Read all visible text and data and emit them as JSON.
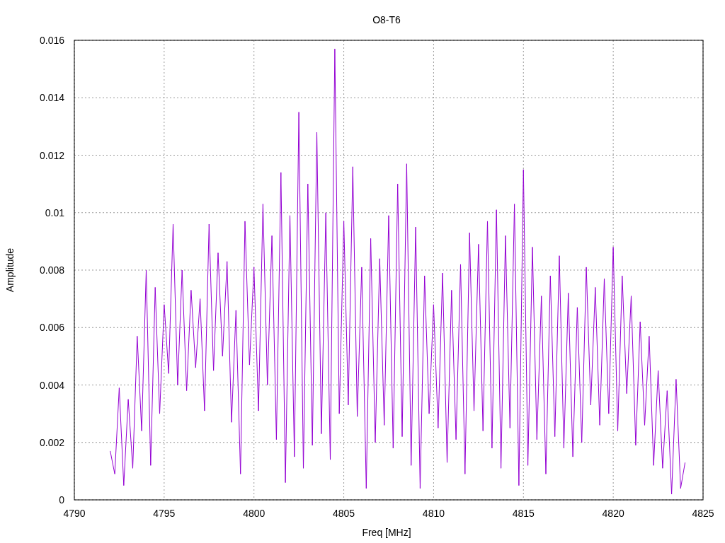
{
  "chart_data": {
    "type": "line",
    "title": "O8-T6",
    "xlabel": "Freq [MHz]",
    "ylabel": "Amplitude",
    "grid": true,
    "xlim": [
      4790,
      4825
    ],
    "ylim": [
      0,
      0.016
    ],
    "xticks": [
      4790,
      4795,
      4800,
      4805,
      4810,
      4815,
      4820,
      4825
    ],
    "yticks": [
      0,
      0.002,
      0.004,
      0.006,
      0.008,
      0.01,
      0.012,
      0.014,
      0.016
    ],
    "x": [
      4792,
      4792.25,
      4792.5,
      4792.75,
      4793,
      4793.25,
      4793.5,
      4793.75,
      4794,
      4794.25,
      4794.5,
      4794.75,
      4795,
      4795.25,
      4795.5,
      4795.75,
      4796,
      4796.25,
      4796.5,
      4796.75,
      4797,
      4797.25,
      4797.5,
      4797.75,
      4798,
      4798.25,
      4798.5,
      4798.75,
      4799,
      4799.25,
      4799.5,
      4799.75,
      4800,
      4800.25,
      4800.5,
      4800.75,
      4801,
      4801.25,
      4801.5,
      4801.75,
      4802,
      4802.25,
      4802.5,
      4802.75,
      4803,
      4803.25,
      4803.5,
      4803.75,
      4804,
      4804.25,
      4804.5,
      4804.75,
      4805,
      4805.25,
      4805.5,
      4805.75,
      4806,
      4806.25,
      4806.5,
      4806.75,
      4807,
      4807.25,
      4807.5,
      4807.75,
      4808,
      4808.25,
      4808.5,
      4808.75,
      4809,
      4809.25,
      4809.5,
      4809.75,
      4810,
      4810.25,
      4810.5,
      4810.75,
      4811,
      4811.25,
      4811.5,
      4811.75,
      4812,
      4812.25,
      4812.5,
      4812.75,
      4813,
      4813.25,
      4813.5,
      4813.75,
      4814,
      4814.25,
      4814.5,
      4814.75,
      4815,
      4815.25,
      4815.5,
      4815.75,
      4816,
      4816.25,
      4816.5,
      4816.75,
      4817,
      4817.25,
      4817.5,
      4817.75,
      4818,
      4818.25,
      4818.5,
      4818.75,
      4819,
      4819.25,
      4819.5,
      4819.75,
      4820,
      4820.25,
      4820.5,
      4820.75,
      4821,
      4821.25,
      4821.5,
      4821.75,
      4822,
      4822.25,
      4822.5,
      4822.75,
      4823,
      4823.25,
      4823.5,
      4823.75,
      4824
    ],
    "series": [
      {
        "color": "#9400d3",
        "values": [
          0.0017,
          0.0009,
          0.0039,
          0.0005,
          0.0035,
          0.0011,
          0.0057,
          0.0024,
          0.008,
          0.0012,
          0.0074,
          0.003,
          0.0068,
          0.0044,
          0.0096,
          0.004,
          0.008,
          0.0038,
          0.0073,
          0.0046,
          0.007,
          0.0031,
          0.0096,
          0.0045,
          0.0086,
          0.005,
          0.0083,
          0.0027,
          0.0066,
          0.0009,
          0.0097,
          0.0047,
          0.0081,
          0.0031,
          0.0103,
          0.004,
          0.0092,
          0.0021,
          0.0114,
          0.0006,
          0.0099,
          0.0015,
          0.0135,
          0.0011,
          0.011,
          0.0019,
          0.0128,
          0.0023,
          0.01,
          0.0014,
          0.0157,
          0.003,
          0.0097,
          0.0033,
          0.0116,
          0.0029,
          0.0081,
          0.0004,
          0.0091,
          0.002,
          0.0084,
          0.0026,
          0.0099,
          0.0018,
          0.011,
          0.0022,
          0.0117,
          0.0012,
          0.0095,
          0.0004,
          0.0078,
          0.003,
          0.0068,
          0.0025,
          0.0079,
          0.0013,
          0.0073,
          0.0021,
          0.0082,
          0.0009,
          0.0093,
          0.0031,
          0.0089,
          0.0024,
          0.0097,
          0.0018,
          0.0101,
          0.0011,
          0.0092,
          0.0025,
          0.0103,
          0.0005,
          0.0115,
          0.0012,
          0.0088,
          0.0021,
          0.0071,
          0.0009,
          0.0078,
          0.0022,
          0.0085,
          0.0018,
          0.0072,
          0.0015,
          0.0067,
          0.002,
          0.0081,
          0.0033,
          0.0074,
          0.0026,
          0.0077,
          0.003,
          0.0088,
          0.0024,
          0.0078,
          0.0037,
          0.0071,
          0.0019,
          0.0062,
          0.0026,
          0.0057,
          0.0012,
          0.0045,
          0.0011,
          0.0038,
          0.0002,
          0.0042,
          0.0004,
          0.0013
        ]
      }
    ]
  }
}
